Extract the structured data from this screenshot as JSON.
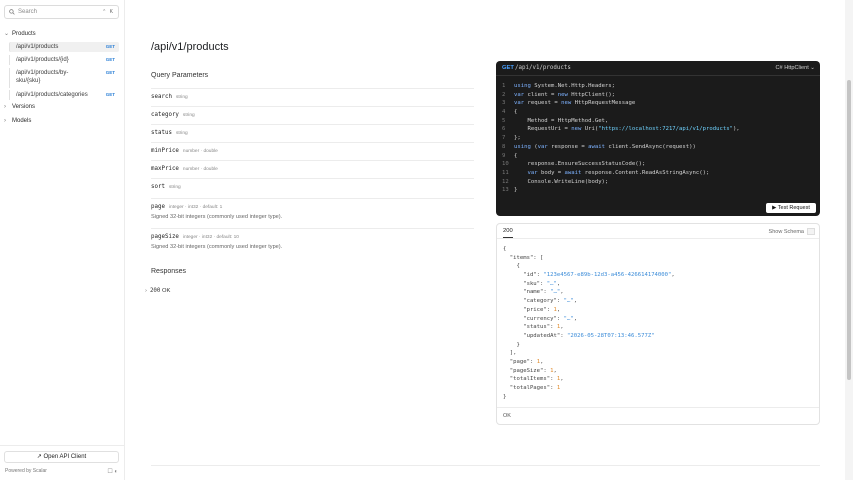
{
  "search": {
    "placeholder": "Search",
    "shortcut": "⌃ K"
  },
  "sidebar": {
    "groups": [
      {
        "label": "Products",
        "chevron": "⌄"
      },
      {
        "label": "Versions",
        "chevron": "›"
      },
      {
        "label": "Models",
        "chevron": "›"
      }
    ],
    "items": [
      {
        "label": "/api/v1/products",
        "method": "GET"
      },
      {
        "label": "/api/v1/products/{id}",
        "method": "GET"
      },
      {
        "label": "/api/v1/products/by-sku/{sku}",
        "method": "GET"
      },
      {
        "label": "/api/v1/products/categories",
        "method": "GET"
      }
    ],
    "open_client": "Open API Client",
    "powered_by": "Powered by Scalar",
    "toggles": "☐ ◐"
  },
  "main": {
    "title": "/api/v1/products",
    "query_heading": "Query Parameters",
    "params": [
      {
        "name": "search",
        "meta": "string",
        "desc": ""
      },
      {
        "name": "category",
        "meta": "string",
        "desc": ""
      },
      {
        "name": "status",
        "meta": "string",
        "desc": ""
      },
      {
        "name": "minPrice",
        "meta": "number · double",
        "desc": ""
      },
      {
        "name": "maxPrice",
        "meta": "number · double",
        "desc": ""
      },
      {
        "name": "sort",
        "meta": "string",
        "desc": ""
      },
      {
        "name": "page",
        "meta": "integer · int32 · default: 1",
        "desc": "Signed 32-bit integers (commonly used integer type)."
      },
      {
        "name": "pageSize",
        "meta": "integer · int32 · default: 10",
        "desc": "Signed 32-bit integers (commonly used integer type)."
      }
    ],
    "responses_heading": "Responses",
    "response_code": "200",
    "response_text": "OK"
  },
  "code": {
    "method": "GET",
    "path": "/api/v1/products",
    "client": "C# HttpClient ⌄",
    "lines": [
      "using System.Net.Http.Headers;",
      "var client = new HttpClient();",
      "var request = new HttpRequestMessage",
      "{",
      "    Method = HttpMethod.Get,",
      "    RequestUri = new Uri(\"https://localhost:7217/api/v1/products\"),",
      "};",
      "using (var response = await client.SendAsync(request))",
      "{",
      "    response.EnsureSuccessStatusCode();",
      "    var body = await response.Content.ReadAsStringAsync();",
      "    Console.WriteLine(body);",
      "}"
    ],
    "test_button": "Test Request"
  },
  "response_panel": {
    "tab": "200",
    "schema_toggle": "Show Schema",
    "json_lines": [
      "{",
      "  \"items\": [",
      "    {",
      "      \"id\": \"123e4567-e89b-12d3-a456-426614174000\",",
      "      \"sku\": \"…\",",
      "      \"name\": \"…\",",
      "      \"category\": \"…\",",
      "      \"price\": 1,",
      "      \"currency\": \"…\",",
      "      \"status\": 1,",
      "      \"updatedAt\": \"2026-05-28T07:13:46.577Z\"",
      "    }",
      "  ],",
      "  \"page\": 1,",
      "  \"pageSize\": 1,",
      "  \"totalItems\": 1,",
      "  \"totalPages\": 1",
      "}"
    ],
    "footer": "OK"
  },
  "colors": {
    "accent": "#2b7fd6",
    "code_bg": "#1b1b1b"
  }
}
